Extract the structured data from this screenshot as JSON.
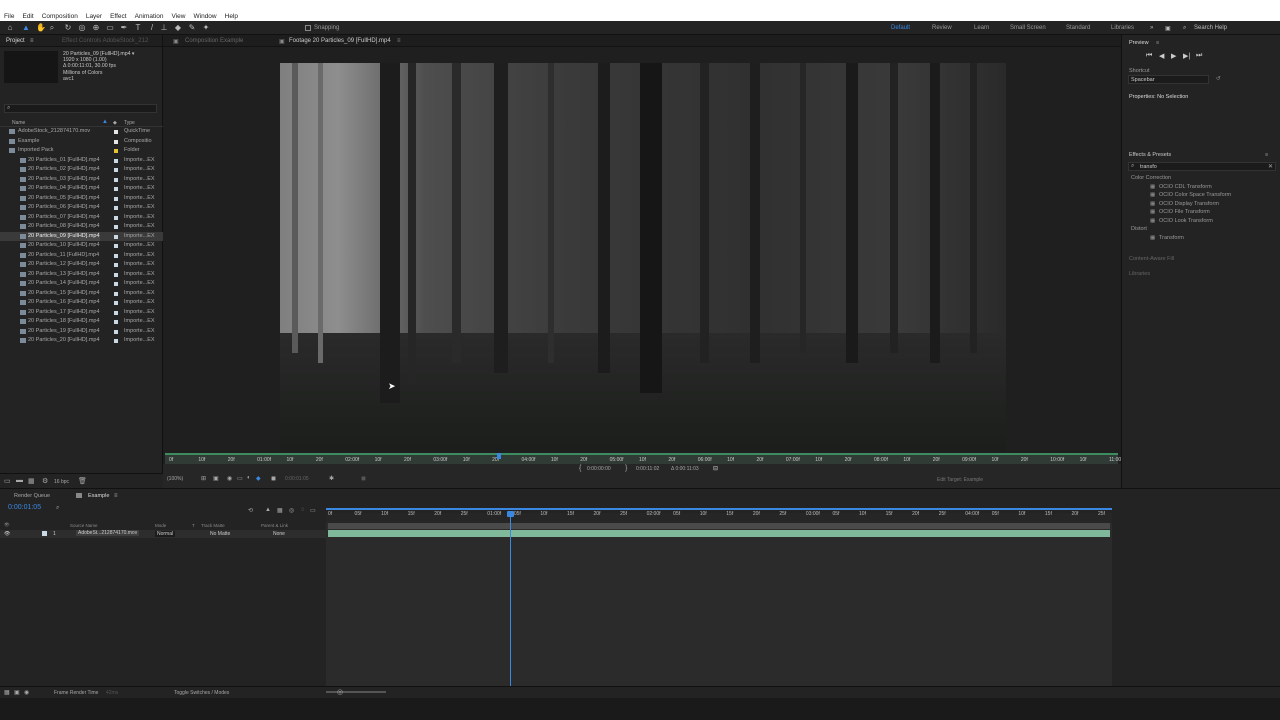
{
  "menu": [
    "File",
    "Edit",
    "Composition",
    "Layer",
    "Effect",
    "Animation",
    "View",
    "Window",
    "Help"
  ],
  "toolbar": {
    "snapping": "Snapping",
    "workspaces": [
      "Default",
      "Review",
      "Learn",
      "Small Screen",
      "Standard",
      "Libraries"
    ],
    "search_placeholder": "Search Help"
  },
  "project": {
    "tab": "Project",
    "tab2": "Effect Controls AdobeStock_212",
    "selected_name": "20 Particles_09 [FullHD].mp4 ▾",
    "selected_res": "1920 x 1080 (1.00)",
    "selected_dur": "Δ 0:00:11:01, 30.00 fps",
    "selected_col": "Millions of Colors",
    "selected_codec": "avc1",
    "col_name": "Name",
    "col_type": "Type",
    "items": [
      {
        "name": "AdobeStock_212874170.mov",
        "type": "QuickTime",
        "color": "#e6e6e6",
        "indent": 0,
        "sel": false
      },
      {
        "name": "Example",
        "type": "Compositio",
        "color": "#e6e6e6",
        "indent": 0,
        "sel": false
      },
      {
        "name": "Imported Pack",
        "type": "Folder",
        "color": "#e5c233",
        "indent": 0,
        "sel": false
      },
      {
        "name": "20 Particles_01 [FullHD].mp4",
        "type": "Importe...EX",
        "color": "#c9d9e6",
        "indent": 1,
        "sel": false
      },
      {
        "name": "20 Particles_02 [FullHD].mp4",
        "type": "Importe...EX",
        "color": "#c9d9e6",
        "indent": 1,
        "sel": false
      },
      {
        "name": "20 Particles_03 [FullHD].mp4",
        "type": "Importe...EX",
        "color": "#c9d9e6",
        "indent": 1,
        "sel": false
      },
      {
        "name": "20 Particles_04 [FullHD].mp4",
        "type": "Importe...EX",
        "color": "#c9d9e6",
        "indent": 1,
        "sel": false
      },
      {
        "name": "20 Particles_05 [FullHD].mp4",
        "type": "Importe...EX",
        "color": "#c9d9e6",
        "indent": 1,
        "sel": false
      },
      {
        "name": "20 Particles_06 [FullHD].mp4",
        "type": "Importe...EX",
        "color": "#c9d9e6",
        "indent": 1,
        "sel": false
      },
      {
        "name": "20 Particles_07 [FullHD].mp4",
        "type": "Importe...EX",
        "color": "#c9d9e6",
        "indent": 1,
        "sel": false
      },
      {
        "name": "20 Particles_08 [FullHD].mp4",
        "type": "Importe...EX",
        "color": "#c9d9e6",
        "indent": 1,
        "sel": false
      },
      {
        "name": "20 Particles_09 [FullHD].mp4",
        "type": "Importe...EX",
        "color": "#c9d9e6",
        "indent": 1,
        "sel": true
      },
      {
        "name": "20 Particles_10 [FullHD].mp4",
        "type": "Importe...EX",
        "color": "#c9d9e6",
        "indent": 1,
        "sel": false
      },
      {
        "name": "20 Particles_11 [FullHD].mp4",
        "type": "Importe...EX",
        "color": "#c9d9e6",
        "indent": 1,
        "sel": false
      },
      {
        "name": "20 Particles_12 [FullHD].mp4",
        "type": "Importe...EX",
        "color": "#c9d9e6",
        "indent": 1,
        "sel": false
      },
      {
        "name": "20 Particles_13 [FullHD].mp4",
        "type": "Importe...EX",
        "color": "#c9d9e6",
        "indent": 1,
        "sel": false
      },
      {
        "name": "20 Particles_14 [FullHD].mp4",
        "type": "Importe...EX",
        "color": "#c9d9e6",
        "indent": 1,
        "sel": false
      },
      {
        "name": "20 Particles_15 [FullHD].mp4",
        "type": "Importe...EX",
        "color": "#c9d9e6",
        "indent": 1,
        "sel": false
      },
      {
        "name": "20 Particles_16 [FullHD].mp4",
        "type": "Importe...EX",
        "color": "#c9d9e6",
        "indent": 1,
        "sel": false
      },
      {
        "name": "20 Particles_17 [FullHD].mp4",
        "type": "Importe...EX",
        "color": "#c9d9e6",
        "indent": 1,
        "sel": false
      },
      {
        "name": "20 Particles_18 [FullHD].mp4",
        "type": "Importe...EX",
        "color": "#c9d9e6",
        "indent": 1,
        "sel": false
      },
      {
        "name": "20 Particles_19 [FullHD].mp4",
        "type": "Importe...EX",
        "color": "#c9d9e6",
        "indent": 1,
        "sel": false
      },
      {
        "name": "20 Particles_20 [FullHD].mp4",
        "type": "Importe...EX",
        "color": "#c9d9e6",
        "indent": 1,
        "sel": false
      }
    ],
    "bpc": "16 bpc"
  },
  "viewer": {
    "tab1": "Composition Example",
    "tab2": "Footage 20 Particles_09 [FullHD].mp4",
    "ruler": [
      "0f",
      "10f",
      "20f",
      "01:00f",
      "10f",
      "20f",
      "02:00f",
      "10f",
      "20f",
      "03:00f",
      "10f",
      "20f",
      "04:00f",
      "10f",
      "20f",
      "05:00f",
      "10f",
      "20f",
      "06:00f",
      "10f",
      "20f",
      "07:00f",
      "10f",
      "20f",
      "08:00f",
      "10f",
      "20f",
      "09:00f",
      "10f",
      "20f",
      "10:00f",
      "10f",
      "11:00f"
    ],
    "in": "0:00:00:00",
    "out": "0:00:11:02",
    "dur": "Δ 0:00:11:03",
    "zoom": "(100%)",
    "timecode": "0:00:01:05",
    "edit_target": "Edit Target: Example"
  },
  "right": {
    "preview": "Preview",
    "shortcut": "Shortcut",
    "shortcut_val": "Spacebar",
    "properties": "Properties: No Selection",
    "effects": "Effects & Presets",
    "search": "transfo",
    "fx": [
      {
        "label": "Color Correction",
        "kind": "cat"
      },
      {
        "label": "OCIO CDL Transform",
        "kind": "item"
      },
      {
        "label": "OCIO Color Space Transform",
        "kind": "item"
      },
      {
        "label": "OCIO Display Transform",
        "kind": "item"
      },
      {
        "label": "OCIO File Transform",
        "kind": "item"
      },
      {
        "label": "OCIO Look Transform",
        "kind": "item"
      },
      {
        "label": "Distort",
        "kind": "cat"
      },
      {
        "label": "Transform",
        "kind": "item"
      }
    ],
    "content_aware": "Content-Aware Fill",
    "libraries": "Libraries"
  },
  "timeline": {
    "tab_render": "Render Queue",
    "tab_comp": "Example",
    "timecode": "0:00:01:05",
    "cols": {
      "source": "Source Name",
      "mode": "Mode",
      "t": "T",
      "trackmatte": "Track Matte",
      "parent": "Parent & Link"
    },
    "layer": {
      "num": "1",
      "name": "AdobeSt...212874170.mov",
      "mode": "Normal",
      "matte": "No Matte",
      "parent": "None"
    },
    "ticks": [
      "0f",
      "05f",
      "10f",
      "15f",
      "20f",
      "25f",
      "01:00f",
      "05f",
      "10f",
      "15f",
      "20f",
      "25f",
      "02:00f",
      "05f",
      "10f",
      "15f",
      "20f",
      "25f",
      "03:00f",
      "05f",
      "10f",
      "15f",
      "20f",
      "25f",
      "04:00f",
      "05f",
      "10f",
      "15f",
      "20f",
      "25f"
    ],
    "frame_render": "Frame Render Time",
    "frame_render_val": "42ms",
    "toggle": "Toggle Switches / Modes"
  }
}
